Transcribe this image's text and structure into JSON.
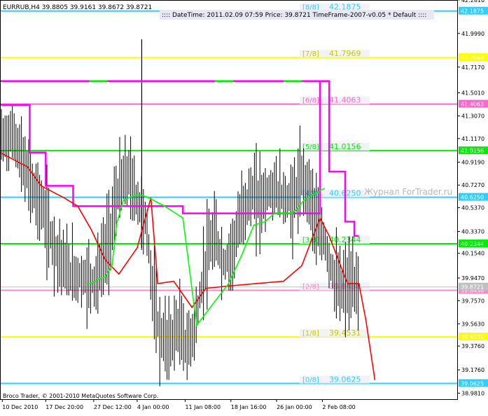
{
  "header": {
    "symbol_line": "EURRUB,H4  39.8805 39.9161 39.8672 39.8721",
    "info_line": ":::: DateTime: 2011.02.09 07:59   Price: 39.8721   TimeFrame-2007-v0.05   *  Default  ::::"
  },
  "footer": {
    "copyright": "Broco Trader, © 2001-2010 MetaQuotes Software Corp."
  },
  "watermark": "Журнал ForTrader.ru",
  "colors": {
    "background": "#ffffff",
    "candles": "#000000",
    "level_0_8": "#33ccff",
    "level_1_8": "#ffff00",
    "level_2_8": "#ff88cc",
    "level_3_8": "#00ee00",
    "level_4_8": "#33ccff",
    "level_5_8": "#00ee00",
    "level_6_8": "#ff66cc",
    "level_7_8": "#ffff00",
    "level_8_8": "#33ccff",
    "magenta_line": "#ff00ff",
    "red_line": "#ff0000",
    "green_line": "#00ff00",
    "price_tag": "#c0c0c0"
  },
  "chart_data": {
    "type": "candlestick",
    "symbol": "EURRUB",
    "timeframe": "H4",
    "ylim": [
      38.93,
      42.28
    ],
    "y_ticks": [
      "42.2810",
      "41.9990",
      "41.7170",
      "41.5010",
      "41.3070",
      "41.1170",
      "40.9190",
      "40.7270",
      "40.5370",
      "40.3370",
      "40.1540",
      "39.9470",
      "39.7570",
      "39.5630",
      "39.3760",
      "39.1760",
      "38.9810"
    ],
    "x_ticks": [
      "10 Dec 2010",
      "17 Dec 20:00",
      "27 Dec 12:00",
      "4 Jan 00:00",
      "11 Jan 08:00",
      "18 Jan 16:00",
      "26 Jan 00:00",
      "2 Feb 08:00"
    ],
    "levels": [
      {
        "label": "[8/8]",
        "value": 42.1875,
        "value_text": "42.1875",
        "axis_label": "42.1875"
      },
      {
        "label": "[7/8]",
        "value": 41.7969,
        "value_text": "41.7969",
        "axis_label": "41.7969"
      },
      {
        "label": "[6/8]",
        "value": 41.4063,
        "value_text": "41.4063",
        "axis_label": "41.4063"
      },
      {
        "label": "[5/8]",
        "value": 41.0156,
        "value_text": "41.0156",
        "axis_label": "41.0156"
      },
      {
        "label": "[4/8]",
        "value": 40.625,
        "value_text": "40.6250",
        "axis_label": "40.6250"
      },
      {
        "label": "[3/8]",
        "value": 40.2344,
        "value_text": "40.2344",
        "axis_label": "40.2344"
      },
      {
        "label": "[2/8]",
        "value": 39.8438,
        "value_text": "39.8438",
        "axis_label": "39.8438"
      },
      {
        "label": "[1/8]",
        "value": 39.4531,
        "value_text": "39.4531",
        "axis_label": "39.4531"
      },
      {
        "label": "[0/8]",
        "value": 39.0625,
        "value_text": "39.0625",
        "axis_label": "39.0625"
      }
    ],
    "current_price": 39.8721,
    "current_price_text": "39.8721",
    "magenta_steps": [
      {
        "x0": 0.0,
        "x1": 0.065,
        "y": 41.4
      },
      {
        "x0": 0.065,
        "x1": 0.1,
        "y": 41.0
      },
      {
        "x0": 0.1,
        "x1": 0.16,
        "y": 40.72
      },
      {
        "x0": 0.16,
        "x1": 0.4,
        "y": 40.55
      },
      {
        "x0": 0.4,
        "x1": 0.7,
        "y": 40.49
      },
      {
        "x0": 0.7,
        "x1": 0.72,
        "y": 41.6
      },
      {
        "x0": 0.72,
        "x1": 0.755,
        "y": 40.84
      },
      {
        "x0": 0.755,
        "x1": 0.775,
        "y": 40.42
      },
      {
        "x0": 0.775,
        "x1": 0.785,
        "y": 40.3
      }
    ],
    "magenta_top_segment": {
      "x0": 0.0,
      "x1": 0.7,
      "y": 41.6
    },
    "red_line": [
      [
        0.0,
        41.0
      ],
      [
        0.06,
        40.88
      ],
      [
        0.09,
        40.72
      ],
      [
        0.14,
        40.62
      ],
      [
        0.17,
        40.55
      ],
      [
        0.2,
        40.35
      ],
      [
        0.23,
        40.1
      ],
      [
        0.26,
        39.98
      ],
      [
        0.3,
        40.2
      ],
      [
        0.33,
        40.62
      ],
      [
        0.345,
        39.9
      ],
      [
        0.38,
        39.92
      ],
      [
        0.42,
        39.7
      ],
      [
        0.45,
        39.86
      ],
      [
        0.5,
        39.88
      ],
      [
        0.56,
        39.9
      ],
      [
        0.62,
        39.92
      ],
      [
        0.66,
        40.05
      ],
      [
        0.7,
        40.45
      ],
      [
        0.72,
        40.3
      ],
      [
        0.74,
        40.1
      ],
      [
        0.76,
        39.9
      ],
      [
        0.785,
        39.9
      ],
      [
        0.8,
        39.6
      ],
      [
        0.82,
        39.09
      ]
    ],
    "green_line": [
      [
        0.19,
        39.89
      ],
      [
        0.23,
        39.96
      ],
      [
        0.245,
        40.05
      ],
      [
        0.255,
        40.4
      ],
      [
        0.27,
        40.6
      ],
      [
        0.3,
        40.65
      ],
      [
        0.32,
        40.63
      ],
      [
        0.36,
        40.55
      ],
      [
        0.4,
        40.45
      ],
      [
        0.43,
        39.55
      ],
      [
        0.46,
        39.7
      ],
      [
        0.5,
        39.9
      ],
      [
        0.53,
        40.15
      ],
      [
        0.555,
        40.39
      ],
      [
        0.58,
        40.42
      ],
      [
        0.6,
        40.49
      ],
      [
        0.64,
        40.49
      ],
      [
        0.665,
        40.6
      ],
      [
        0.69,
        40.66
      ],
      [
        0.71,
        40.7
      ]
    ],
    "candle_profile": [
      [
        0.0,
        41.1
      ],
      [
        0.03,
        41.15
      ],
      [
        0.06,
        40.8
      ],
      [
        0.09,
        40.55
      ],
      [
        0.12,
        40.2
      ],
      [
        0.15,
        40.0
      ],
      [
        0.18,
        39.95
      ],
      [
        0.21,
        39.92
      ],
      [
        0.24,
        40.3
      ],
      [
        0.26,
        40.7
      ],
      [
        0.28,
        40.82
      ],
      [
        0.3,
        40.6
      ],
      [
        0.32,
        40.4
      ],
      [
        0.335,
        39.8
      ],
      [
        0.35,
        39.45
      ],
      [
        0.37,
        39.4
      ],
      [
        0.39,
        39.55
      ],
      [
        0.41,
        39.35
      ],
      [
        0.43,
        39.6
      ],
      [
        0.45,
        40.1
      ],
      [
        0.47,
        40.3
      ],
      [
        0.49,
        40.05
      ],
      [
        0.51,
        40.2
      ],
      [
        0.53,
        40.5
      ],
      [
        0.55,
        40.65
      ],
      [
        0.57,
        40.6
      ],
      [
        0.6,
        40.7
      ],
      [
        0.62,
        40.62
      ],
      [
        0.64,
        40.58
      ],
      [
        0.66,
        40.78
      ],
      [
        0.675,
        40.7
      ],
      [
        0.69,
        40.45
      ],
      [
        0.71,
        40.25
      ],
      [
        0.73,
        39.95
      ],
      [
        0.745,
        39.85
      ],
      [
        0.76,
        39.88
      ],
      [
        0.785,
        39.87
      ]
    ],
    "candle_spikes": [
      {
        "x": 0.31,
        "high": 41.95,
        "low": 40.2
      }
    ]
  }
}
